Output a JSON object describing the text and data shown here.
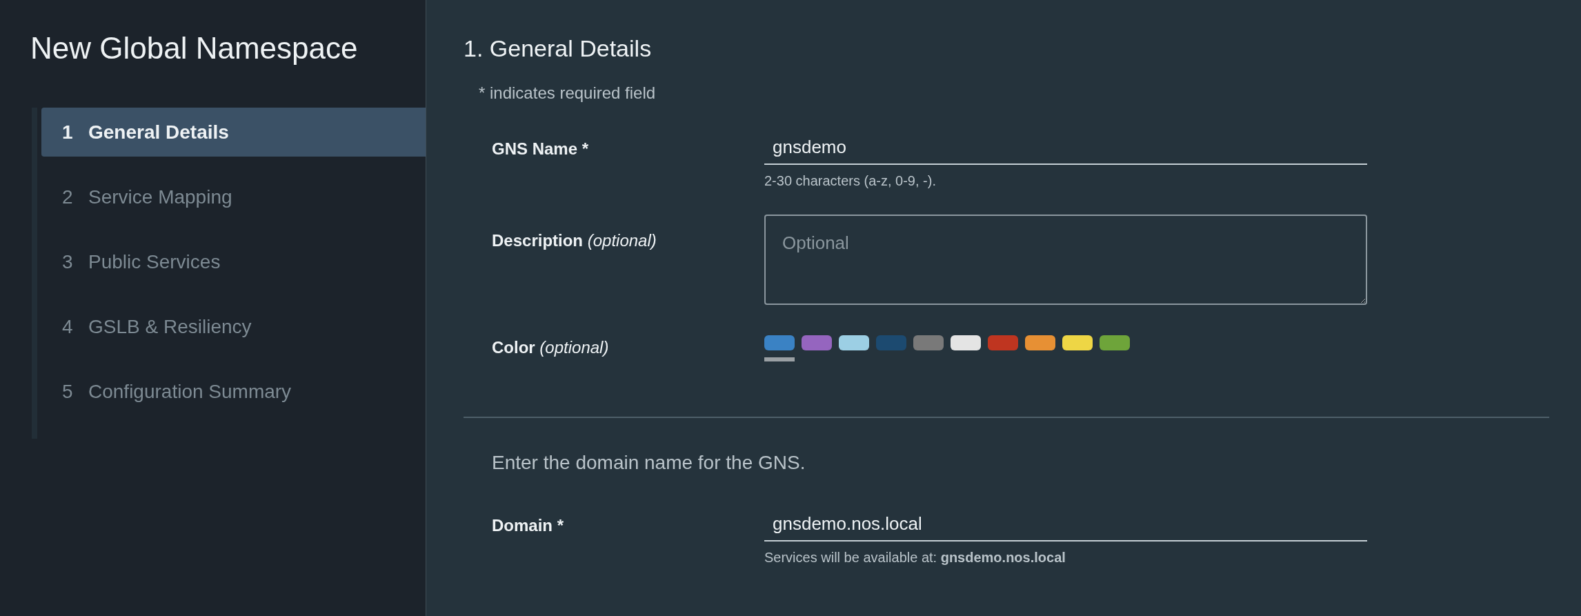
{
  "sidebar": {
    "title": "New Global Namespace",
    "steps": [
      {
        "number": "1",
        "label": "General Details",
        "selected": true
      },
      {
        "number": "2",
        "label": "Service Mapping",
        "selected": false
      },
      {
        "number": "3",
        "label": "Public Services",
        "selected": false
      },
      {
        "number": "4",
        "label": "GSLB & Resiliency",
        "selected": false
      },
      {
        "number": "5",
        "label": "Configuration Summary",
        "selected": false
      }
    ]
  },
  "main": {
    "heading": "1. General Details",
    "required_note": "* indicates required field",
    "gns_name": {
      "label": "GNS Name *",
      "value": "gnsdemo",
      "help": "2-30 characters (a-z, 0-9, -)."
    },
    "description": {
      "label": "Description",
      "optional": "(optional)",
      "placeholder": "Optional"
    },
    "color": {
      "label": "Color",
      "optional": "(optional)",
      "swatches": [
        {
          "color": "#3a82c4",
          "selected": true
        },
        {
          "color": "#9565bf",
          "selected": false
        },
        {
          "color": "#9ccfe4",
          "selected": false
        },
        {
          "color": "#1c4a70",
          "selected": false
        },
        {
          "color": "#797979",
          "selected": false
        },
        {
          "color": "#e4e4e4",
          "selected": false
        },
        {
          "color": "#bf3520",
          "selected": false
        },
        {
          "color": "#e79034",
          "selected": false
        },
        {
          "color": "#eed645",
          "selected": false
        },
        {
          "color": "#6ea43a",
          "selected": false
        }
      ]
    },
    "domain_intro": "Enter the domain name for the GNS.",
    "domain": {
      "label": "Domain *",
      "value": "gnsdemo.nos.local",
      "help": "Services will be available at: **gnsdemo.nos.local**"
    }
  }
}
